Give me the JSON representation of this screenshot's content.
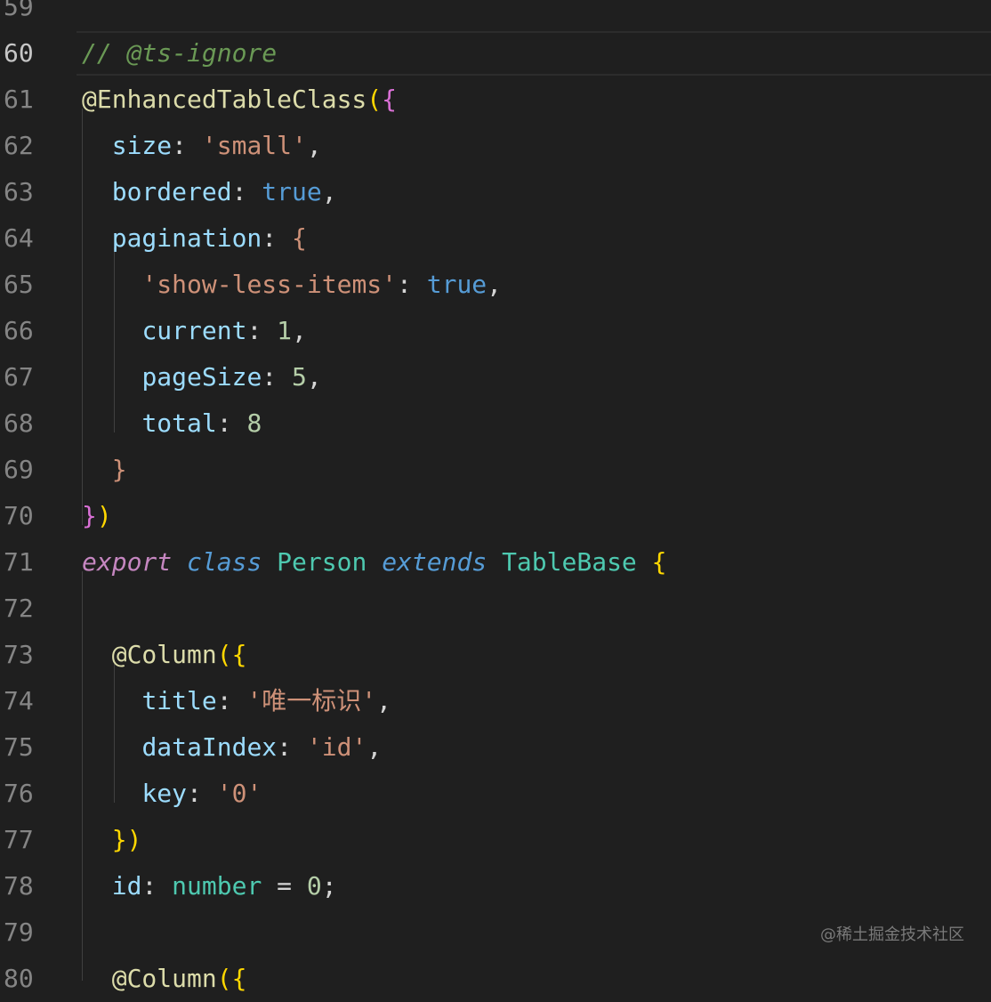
{
  "editor": {
    "current_line": "60",
    "lines": [
      {
        "num": "59",
        "tokens": []
      },
      {
        "num": "60",
        "tokens": [
          {
            "t": "// @ts-ignore",
            "c": "c-comment"
          }
        ]
      },
      {
        "num": "61",
        "tokens": [
          {
            "t": "@EnhancedTableClass",
            "c": "c-dec"
          },
          {
            "t": "(",
            "c": "c-brk1"
          },
          {
            "t": "{",
            "c": "c-brk2"
          }
        ]
      },
      {
        "num": "62",
        "tokens": [
          {
            "t": "  "
          },
          {
            "t": "size",
            "c": "c-prop"
          },
          {
            "t": ": ",
            "c": "c-punc"
          },
          {
            "t": "'small'",
            "c": "c-str"
          },
          {
            "t": ",",
            "c": "c-punc"
          }
        ]
      },
      {
        "num": "63",
        "tokens": [
          {
            "t": "  "
          },
          {
            "t": "bordered",
            "c": "c-prop"
          },
          {
            "t": ": ",
            "c": "c-punc"
          },
          {
            "t": "true",
            "c": "c-bool"
          },
          {
            "t": ",",
            "c": "c-punc"
          }
        ]
      },
      {
        "num": "64",
        "tokens": [
          {
            "t": "  "
          },
          {
            "t": "pagination",
            "c": "c-prop"
          },
          {
            "t": ": ",
            "c": "c-punc"
          },
          {
            "t": "{",
            "c": "c-str"
          }
        ]
      },
      {
        "num": "65",
        "tokens": [
          {
            "t": "    "
          },
          {
            "t": "'show-less-items'",
            "c": "c-str"
          },
          {
            "t": ": ",
            "c": "c-punc"
          },
          {
            "t": "true",
            "c": "c-bool"
          },
          {
            "t": ",",
            "c": "c-punc"
          }
        ]
      },
      {
        "num": "66",
        "tokens": [
          {
            "t": "    "
          },
          {
            "t": "current",
            "c": "c-prop"
          },
          {
            "t": ": ",
            "c": "c-punc"
          },
          {
            "t": "1",
            "c": "c-num"
          },
          {
            "t": ",",
            "c": "c-punc"
          }
        ]
      },
      {
        "num": "67",
        "tokens": [
          {
            "t": "    "
          },
          {
            "t": "pageSize",
            "c": "c-prop"
          },
          {
            "t": ": ",
            "c": "c-punc"
          },
          {
            "t": "5",
            "c": "c-num"
          },
          {
            "t": ",",
            "c": "c-punc"
          }
        ]
      },
      {
        "num": "68",
        "tokens": [
          {
            "t": "    "
          },
          {
            "t": "total",
            "c": "c-prop"
          },
          {
            "t": ": ",
            "c": "c-punc"
          },
          {
            "t": "8",
            "c": "c-num"
          }
        ]
      },
      {
        "num": "69",
        "tokens": [
          {
            "t": "  "
          },
          {
            "t": "}",
            "c": "c-str"
          }
        ]
      },
      {
        "num": "70",
        "tokens": [
          {
            "t": "}",
            "c": "c-brk2"
          },
          {
            "t": ")",
            "c": "c-brk1"
          }
        ]
      },
      {
        "num": "71",
        "tokens": [
          {
            "t": "export",
            "c": "c-kw-it"
          },
          {
            "t": " "
          },
          {
            "t": "class",
            "c": "c-kw2-it"
          },
          {
            "t": " "
          },
          {
            "t": "Person",
            "c": "c-type"
          },
          {
            "t": " "
          },
          {
            "t": "extends",
            "c": "c-kw2-it"
          },
          {
            "t": " "
          },
          {
            "t": "TableBase",
            "c": "c-type"
          },
          {
            "t": " "
          },
          {
            "t": "{",
            "c": "c-bc"
          }
        ]
      },
      {
        "num": "72",
        "tokens": []
      },
      {
        "num": "73",
        "tokens": [
          {
            "t": "  "
          },
          {
            "t": "@Column",
            "c": "c-dec"
          },
          {
            "t": "(",
            "c": "c-brk1"
          },
          {
            "t": "{",
            "c": "c-brk1"
          }
        ]
      },
      {
        "num": "74",
        "tokens": [
          {
            "t": "    "
          },
          {
            "t": "title",
            "c": "c-prop"
          },
          {
            "t": ": ",
            "c": "c-punc"
          },
          {
            "t": "'唯一标识'",
            "c": "c-str"
          },
          {
            "t": ",",
            "c": "c-punc"
          }
        ]
      },
      {
        "num": "75",
        "tokens": [
          {
            "t": "    "
          },
          {
            "t": "dataIndex",
            "c": "c-prop"
          },
          {
            "t": ": ",
            "c": "c-punc"
          },
          {
            "t": "'id'",
            "c": "c-str"
          },
          {
            "t": ",",
            "c": "c-punc"
          }
        ]
      },
      {
        "num": "76",
        "tokens": [
          {
            "t": "    "
          },
          {
            "t": "key",
            "c": "c-prop"
          },
          {
            "t": ": ",
            "c": "c-punc"
          },
          {
            "t": "'0'",
            "c": "c-str"
          }
        ]
      },
      {
        "num": "77",
        "tokens": [
          {
            "t": "  "
          },
          {
            "t": "}",
            "c": "c-brk1"
          },
          {
            "t": ")",
            "c": "c-brk1"
          }
        ]
      },
      {
        "num": "78",
        "tokens": [
          {
            "t": "  "
          },
          {
            "t": "id",
            "c": "c-prop"
          },
          {
            "t": ": ",
            "c": "c-punc"
          },
          {
            "t": "number",
            "c": "c-type"
          },
          {
            "t": " = ",
            "c": "c-punc"
          },
          {
            "t": "0",
            "c": "c-num"
          },
          {
            "t": ";",
            "c": "c-punc"
          }
        ]
      },
      {
        "num": "79",
        "tokens": []
      },
      {
        "num": "80",
        "tokens": [
          {
            "t": "  "
          },
          {
            "t": "@Column",
            "c": "c-dec"
          },
          {
            "t": "(",
            "c": "c-brk1"
          },
          {
            "t": "{",
            "c": "c-brk1"
          }
        ]
      }
    ]
  },
  "watermark": "@稀土掘金技术社区"
}
